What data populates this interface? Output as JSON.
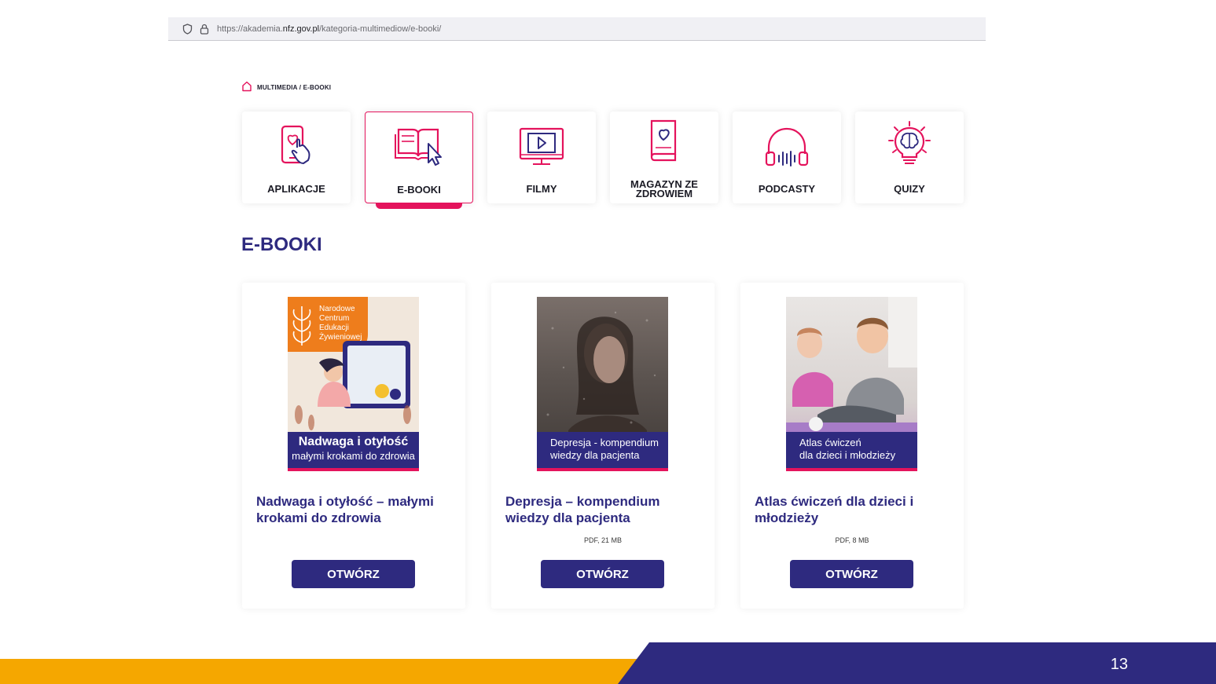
{
  "browser": {
    "url_prefix": "https://akademia.",
    "url_domain": "nfz.gov.pl",
    "url_path": "/kategoria-multimediow/e-booki/"
  },
  "breadcrumb": {
    "text": "MULTIMEDIA / E-BOOKI",
    "icon": "home-icon"
  },
  "categories": [
    {
      "label": "APLIKACJE",
      "icon": "phone-heart-icon",
      "active": false
    },
    {
      "label": "E-BOOKI",
      "icon": "book-cursor-icon",
      "active": true
    },
    {
      "label": "FILMY",
      "icon": "monitor-play-icon",
      "active": false
    },
    {
      "label": "MAGAZYN ZE ZDROWIEM",
      "icon": "book-heart-icon",
      "active": false
    },
    {
      "label": "PODCASTY",
      "icon": "headphones-icon",
      "active": false
    },
    {
      "label": "QUIZY",
      "icon": "lightbulb-brain-icon",
      "active": false
    }
  ],
  "section_title": "E-BOOKI",
  "ebooks": [
    {
      "cover_publisher": [
        "Narodowe",
        "Centrum",
        "Edukacji",
        "Żywieniowej"
      ],
      "cover_title": "Nadwaga i otyłość",
      "cover_subtitle": "małymi krokami do zdrowia",
      "title": "Nadwaga i otyłość – małymi krokami do zdrowia",
      "meta": "",
      "button": "OTWÓRZ"
    },
    {
      "cover_line1": "Depresja - kompendium",
      "cover_line2": "wiedzy dla pacjenta",
      "title": "Depresja – kompendium wiedzy dla pacjenta",
      "meta": "PDF, 21 MB",
      "button": "OTWÓRZ"
    },
    {
      "cover_line1": "Atlas ćwiczeń",
      "cover_line2": "dla dzieci i młodzieży",
      "title": "Atlas ćwiczeń dla dzieci i młodzieży",
      "meta": "PDF, 8 MB",
      "button": "OTWÓRZ"
    }
  ],
  "slide_number": "13",
  "colors": {
    "brand_navy": "#2e2a7f",
    "brand_pink": "#e4135c",
    "footer_orange": "#f5a700"
  }
}
